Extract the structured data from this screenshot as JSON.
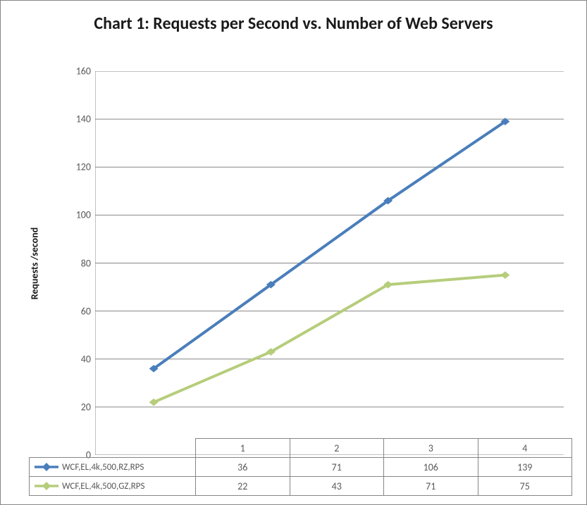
{
  "chart_data": {
    "type": "line",
    "title": "Chart 1: Requests per Second vs. Number of Web Servers",
    "xlabel": "",
    "ylabel": "Requests /second",
    "categories": [
      "1",
      "2",
      "3",
      "4"
    ],
    "series": [
      {
        "name": "WCF,EL,4k,500,RZ,RPS",
        "color": "#4a7ebb",
        "values": [
          36,
          71,
          106,
          139
        ]
      },
      {
        "name": "WCF,EL,4k,500,GZ,RPS",
        "color": "#b6cd7b",
        "values": [
          22,
          43,
          71,
          75
        ]
      }
    ],
    "ylim": [
      0,
      160
    ],
    "ytick_step": 20,
    "grid": true
  }
}
